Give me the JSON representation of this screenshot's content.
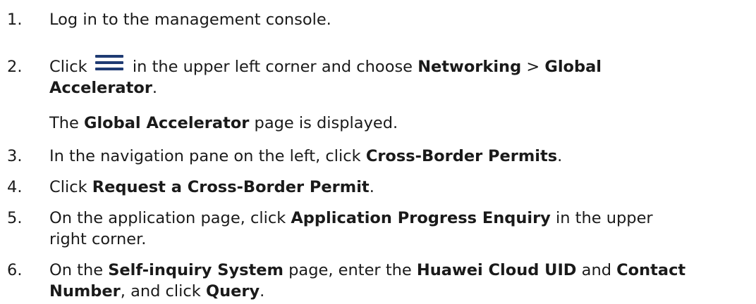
{
  "steps": [
    {
      "number": "1.",
      "lines": [
        [
          {
            "t": "Log in to the management console."
          }
        ]
      ]
    },
    {
      "number": "2.",
      "lines": [
        [
          {
            "t": "Click "
          },
          {
            "icon": "menu-icon"
          },
          {
            "t": " in the upper left corner and choose "
          },
          {
            "t": "Networking",
            "b": true
          },
          {
            "t": " > "
          },
          {
            "t": "Global",
            "b": true
          }
        ],
        [
          {
            "t": "Accelerator",
            "b": true
          },
          {
            "t": "."
          }
        ]
      ],
      "note": [
        {
          "t": "The "
        },
        {
          "t": "Global Accelerator",
          "b": true
        },
        {
          "t": " page is displayed."
        }
      ]
    },
    {
      "number": "3.",
      "lines": [
        [
          {
            "t": "In the navigation pane on the left, click "
          },
          {
            "t": "Cross-Border Permits",
            "b": true
          },
          {
            "t": "."
          }
        ]
      ]
    },
    {
      "number": "4.",
      "lines": [
        [
          {
            "t": "Click "
          },
          {
            "t": "Request a Cross-Border Permit",
            "b": true
          },
          {
            "t": "."
          }
        ]
      ]
    },
    {
      "number": "5.",
      "lines": [
        [
          {
            "t": "On the application page, click "
          },
          {
            "t": "Application Progress Enquiry",
            "b": true
          },
          {
            "t": " in the upper"
          }
        ],
        [
          {
            "t": "right corner."
          }
        ]
      ]
    },
    {
      "number": "6.",
      "lines": [
        [
          {
            "t": "On the "
          },
          {
            "t": "Self-inquiry System",
            "b": true
          },
          {
            "t": " page, enter the "
          },
          {
            "t": "Huawei Cloud UID",
            "b": true
          },
          {
            "t": " and "
          },
          {
            "t": "Contact",
            "b": true
          }
        ],
        [
          {
            "t": "Number",
            "b": true
          },
          {
            "t": ", and click "
          },
          {
            "t": "Query",
            "b": true
          },
          {
            "t": "."
          }
        ]
      ]
    }
  ],
  "colors": {
    "text": "#1a1a1a",
    "icon": "#1f3b73"
  }
}
